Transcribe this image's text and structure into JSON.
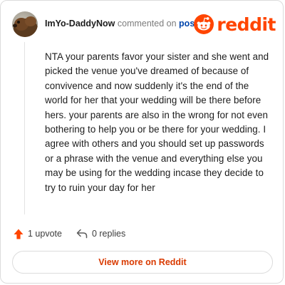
{
  "header": {
    "username": "ImYo-DaddyNow",
    "action_text": "commented on",
    "post_link": "post",
    "logo": {
      "icon": "reddit-snoo-icon",
      "wordmark": "reddit",
      "color": "#ff4500"
    }
  },
  "comment": {
    "body": "NTA your parents favor your sister and she went and picked the venue you've dreamed of because of convivence and now suddenly it's the end of the world for her that your wedding will be there before hers. your parents are also in the wrong for not even bothering to help you or be there for your wedding. I agree with others and you should set up passwords or a phrase with the venue and everything else you may be using for the wedding incase they decide to try to ruin your day for her"
  },
  "actions": {
    "upvote": {
      "icon": "upvote-arrow-icon",
      "label": "1 upvote",
      "color": "#ff4500"
    },
    "replies": {
      "icon": "reply-arrow-icon",
      "label": "0 replies"
    }
  },
  "footer": {
    "view_more_label": "View more on Reddit",
    "accent_color": "#d93a00"
  }
}
